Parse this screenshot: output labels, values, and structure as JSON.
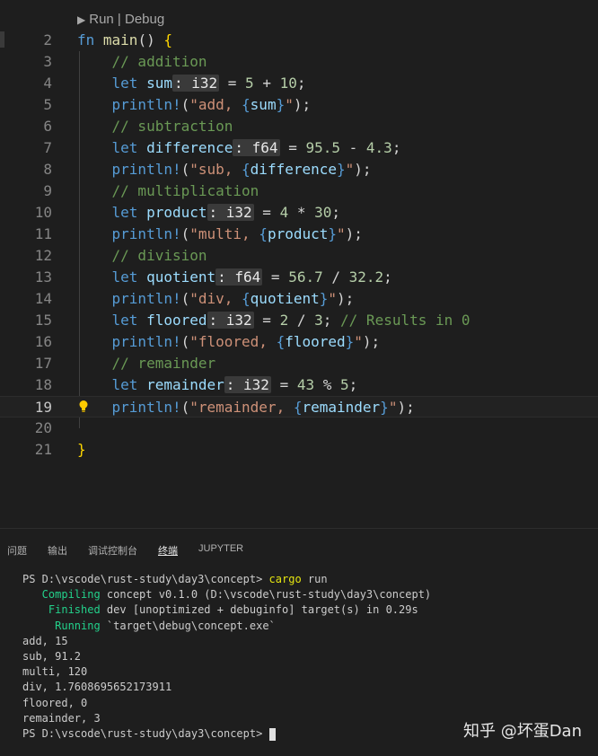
{
  "editor": {
    "codelens": "Run | Debug",
    "lines": [
      {
        "num": "2",
        "tokens": [
          [
            "kw",
            "fn "
          ],
          [
            "fn",
            "main"
          ],
          [
            "punct",
            "() "
          ],
          [
            "brace",
            "{"
          ]
        ]
      },
      {
        "num": "3",
        "tokens": [
          [
            "punct",
            "    "
          ],
          [
            "com",
            "// addition"
          ]
        ]
      },
      {
        "num": "4",
        "tokens": [
          [
            "punct",
            "    "
          ],
          [
            "kw",
            "let "
          ],
          [
            "var",
            "sum"
          ],
          [
            "hint",
            ": i32"
          ],
          [
            "punct",
            " = "
          ],
          [
            "num",
            "5"
          ],
          [
            "punct",
            " + "
          ],
          [
            "num",
            "10"
          ],
          [
            "punct",
            ";"
          ]
        ]
      },
      {
        "num": "5",
        "tokens": [
          [
            "punct",
            "    "
          ],
          [
            "mac",
            "println!"
          ],
          [
            "punct",
            "("
          ],
          [
            "str",
            "\"add, "
          ],
          [
            "kw",
            "{"
          ],
          [
            "var",
            "sum"
          ],
          [
            "kw",
            "}"
          ],
          [
            "str",
            "\""
          ],
          [
            "punct",
            ");"
          ]
        ]
      },
      {
        "num": "6",
        "tokens": [
          [
            "punct",
            "    "
          ],
          [
            "com",
            "// subtraction"
          ]
        ]
      },
      {
        "num": "7",
        "tokens": [
          [
            "punct",
            "    "
          ],
          [
            "kw",
            "let "
          ],
          [
            "var",
            "difference"
          ],
          [
            "hint",
            ": f64"
          ],
          [
            "punct",
            " = "
          ],
          [
            "num",
            "95.5"
          ],
          [
            "punct",
            " - "
          ],
          [
            "num",
            "4.3"
          ],
          [
            "punct",
            ";"
          ]
        ]
      },
      {
        "num": "8",
        "tokens": [
          [
            "punct",
            "    "
          ],
          [
            "mac",
            "println!"
          ],
          [
            "punct",
            "("
          ],
          [
            "str",
            "\"sub, "
          ],
          [
            "kw",
            "{"
          ],
          [
            "var",
            "difference"
          ],
          [
            "kw",
            "}"
          ],
          [
            "str",
            "\""
          ],
          [
            "punct",
            ");"
          ]
        ]
      },
      {
        "num": "9",
        "tokens": [
          [
            "punct",
            "    "
          ],
          [
            "com",
            "// multiplication"
          ]
        ]
      },
      {
        "num": "10",
        "tokens": [
          [
            "punct",
            "    "
          ],
          [
            "kw",
            "let "
          ],
          [
            "var",
            "product"
          ],
          [
            "hint",
            ": i32"
          ],
          [
            "punct",
            " = "
          ],
          [
            "num",
            "4"
          ],
          [
            "punct",
            " * "
          ],
          [
            "num",
            "30"
          ],
          [
            "punct",
            ";"
          ]
        ]
      },
      {
        "num": "11",
        "tokens": [
          [
            "punct",
            "    "
          ],
          [
            "mac",
            "println!"
          ],
          [
            "punct",
            "("
          ],
          [
            "str",
            "\"multi, "
          ],
          [
            "kw",
            "{"
          ],
          [
            "var",
            "product"
          ],
          [
            "kw",
            "}"
          ],
          [
            "str",
            "\""
          ],
          [
            "punct",
            ");"
          ]
        ]
      },
      {
        "num": "12",
        "tokens": [
          [
            "punct",
            "    "
          ],
          [
            "com",
            "// division"
          ]
        ]
      },
      {
        "num": "13",
        "tokens": [
          [
            "punct",
            "    "
          ],
          [
            "kw",
            "let "
          ],
          [
            "var",
            "quotient"
          ],
          [
            "hint",
            ": f64"
          ],
          [
            "punct",
            " = "
          ],
          [
            "num",
            "56.7"
          ],
          [
            "punct",
            " / "
          ],
          [
            "num",
            "32.2"
          ],
          [
            "punct",
            ";"
          ]
        ]
      },
      {
        "num": "14",
        "tokens": [
          [
            "punct",
            "    "
          ],
          [
            "mac",
            "println!"
          ],
          [
            "punct",
            "("
          ],
          [
            "str",
            "\"div, "
          ],
          [
            "kw",
            "{"
          ],
          [
            "var",
            "quotient"
          ],
          [
            "kw",
            "}"
          ],
          [
            "str",
            "\""
          ],
          [
            "punct",
            ");"
          ]
        ]
      },
      {
        "num": "15",
        "tokens": [
          [
            "punct",
            "    "
          ],
          [
            "kw",
            "let "
          ],
          [
            "var",
            "floored"
          ],
          [
            "hint",
            ": i32"
          ],
          [
            "punct",
            " = "
          ],
          [
            "num",
            "2"
          ],
          [
            "punct",
            " / "
          ],
          [
            "num",
            "3"
          ],
          [
            "punct",
            "; "
          ],
          [
            "com",
            "// Results in 0"
          ]
        ]
      },
      {
        "num": "16",
        "tokens": [
          [
            "punct",
            "    "
          ],
          [
            "mac",
            "println!"
          ],
          [
            "punct",
            "("
          ],
          [
            "str",
            "\"floored, "
          ],
          [
            "kw",
            "{"
          ],
          [
            "var",
            "floored"
          ],
          [
            "kw",
            "}"
          ],
          [
            "str",
            "\""
          ],
          [
            "punct",
            ");"
          ]
        ]
      },
      {
        "num": "17",
        "tokens": [
          [
            "punct",
            "    "
          ],
          [
            "com",
            "// remainder"
          ]
        ]
      },
      {
        "num": "18",
        "tokens": [
          [
            "punct",
            "    "
          ],
          [
            "kw",
            "let "
          ],
          [
            "var",
            "remainder"
          ],
          [
            "hint",
            ": i32"
          ],
          [
            "punct",
            " = "
          ],
          [
            "num",
            "43"
          ],
          [
            "punct",
            " % "
          ],
          [
            "num",
            "5"
          ],
          [
            "punct",
            ";"
          ]
        ]
      },
      {
        "num": "19",
        "tokens": [
          [
            "punct",
            "    "
          ],
          [
            "mac",
            "println!"
          ],
          [
            "punct",
            "("
          ],
          [
            "str",
            "\"remainder, "
          ],
          [
            "kw",
            "{"
          ],
          [
            "var",
            "remainder"
          ],
          [
            "kw",
            "}"
          ],
          [
            "str",
            "\""
          ],
          [
            "punct",
            ");"
          ]
        ]
      },
      {
        "num": "20",
        "tokens": []
      },
      {
        "num": "21",
        "tokens": [
          [
            "brace",
            "}"
          ]
        ]
      }
    ],
    "current_line": "19"
  },
  "panel": {
    "tabs": [
      "问题",
      "输出",
      "调试控制台",
      "终端",
      "JUPYTER"
    ],
    "active_tab": "终端",
    "terminal": [
      [
        [
          "plain",
          "PS D:\\vscode\\rust-study\\day3\\concept> "
        ],
        [
          "yellow",
          "cargo"
        ],
        [
          "plain",
          " run"
        ]
      ],
      [
        [
          "green",
          "   Compiling"
        ],
        [
          "plain",
          " concept v0.1.0 (D:\\vscode\\rust-study\\day3\\concept)"
        ]
      ],
      [
        [
          "green",
          "    Finished"
        ],
        [
          "plain",
          " dev [unoptimized + debuginfo] target(s) in 0.29s"
        ]
      ],
      [
        [
          "green",
          "     Running"
        ],
        [
          "plain",
          " `target\\debug\\concept.exe`"
        ]
      ],
      [
        [
          "plain",
          "add, 15"
        ]
      ],
      [
        [
          "plain",
          "sub, 91.2"
        ]
      ],
      [
        [
          "plain",
          "multi, 120"
        ]
      ],
      [
        [
          "plain",
          "div, 1.7608695652173911"
        ]
      ],
      [
        [
          "plain",
          "floored, 0"
        ]
      ],
      [
        [
          "plain",
          "remainder, 3"
        ]
      ],
      [
        [
          "plain",
          "PS D:\\vscode\\rust-study\\day3\\concept> "
        ]
      ]
    ]
  },
  "watermark": "知乎 @坏蛋Dan",
  "colors": {
    "background": "#1e1e1e",
    "keyword": "#569cd6",
    "string": "#ce9178",
    "comment": "#6a9955",
    "number": "#b5cea8",
    "variable": "#9cdcfe",
    "terminal_green": "#23d18b"
  }
}
